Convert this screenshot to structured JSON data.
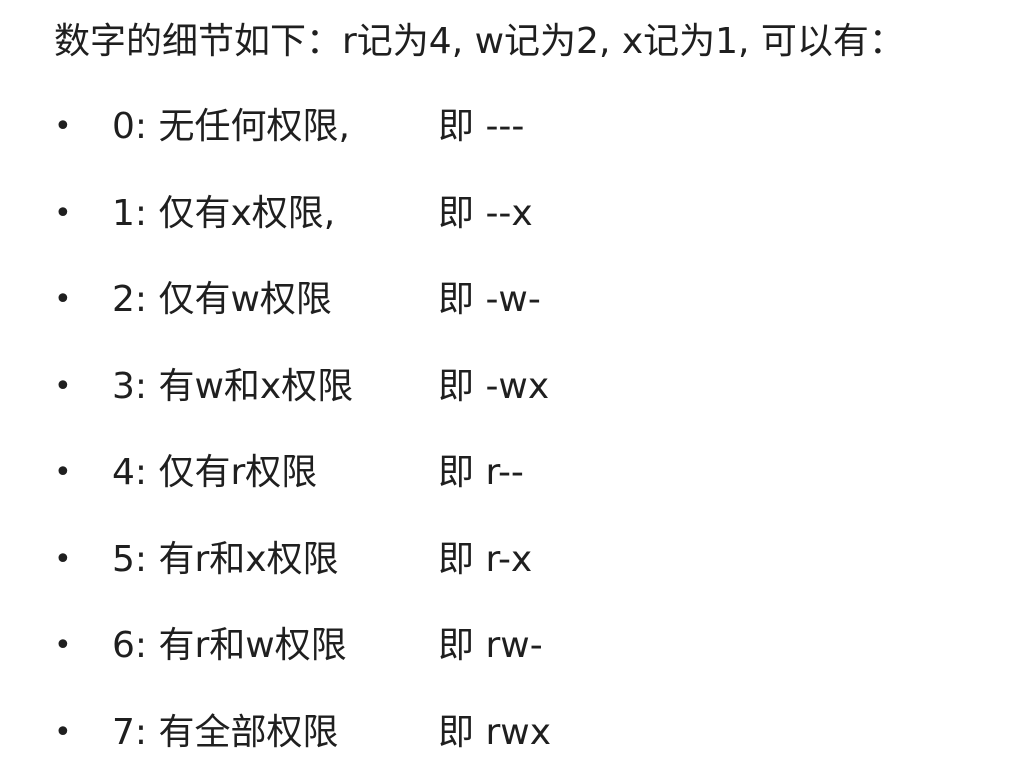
{
  "heading": "数字的细节如下：r记为4, w记为2, x记为1, 可以有：",
  "bullet_glyph": "•",
  "items": [
    {
      "desc": "0: 无任何权限,",
      "symbolic": "即 ---"
    },
    {
      "desc": "1: 仅有x权限,",
      "symbolic": "即 --x"
    },
    {
      "desc": "2: 仅有w权限",
      "symbolic": "即 -w-"
    },
    {
      "desc": "3: 有w和x权限",
      "symbolic": "即 -wx"
    },
    {
      "desc": "4: 仅有r权限",
      "symbolic": "即 r--"
    },
    {
      "desc": "5: 有r和x权限",
      "symbolic": "即 r-x"
    },
    {
      "desc": "6: 有r和w权限",
      "symbolic": "即 rw-"
    },
    {
      "desc": "7: 有全部权限",
      "symbolic": "即 rwx"
    }
  ]
}
